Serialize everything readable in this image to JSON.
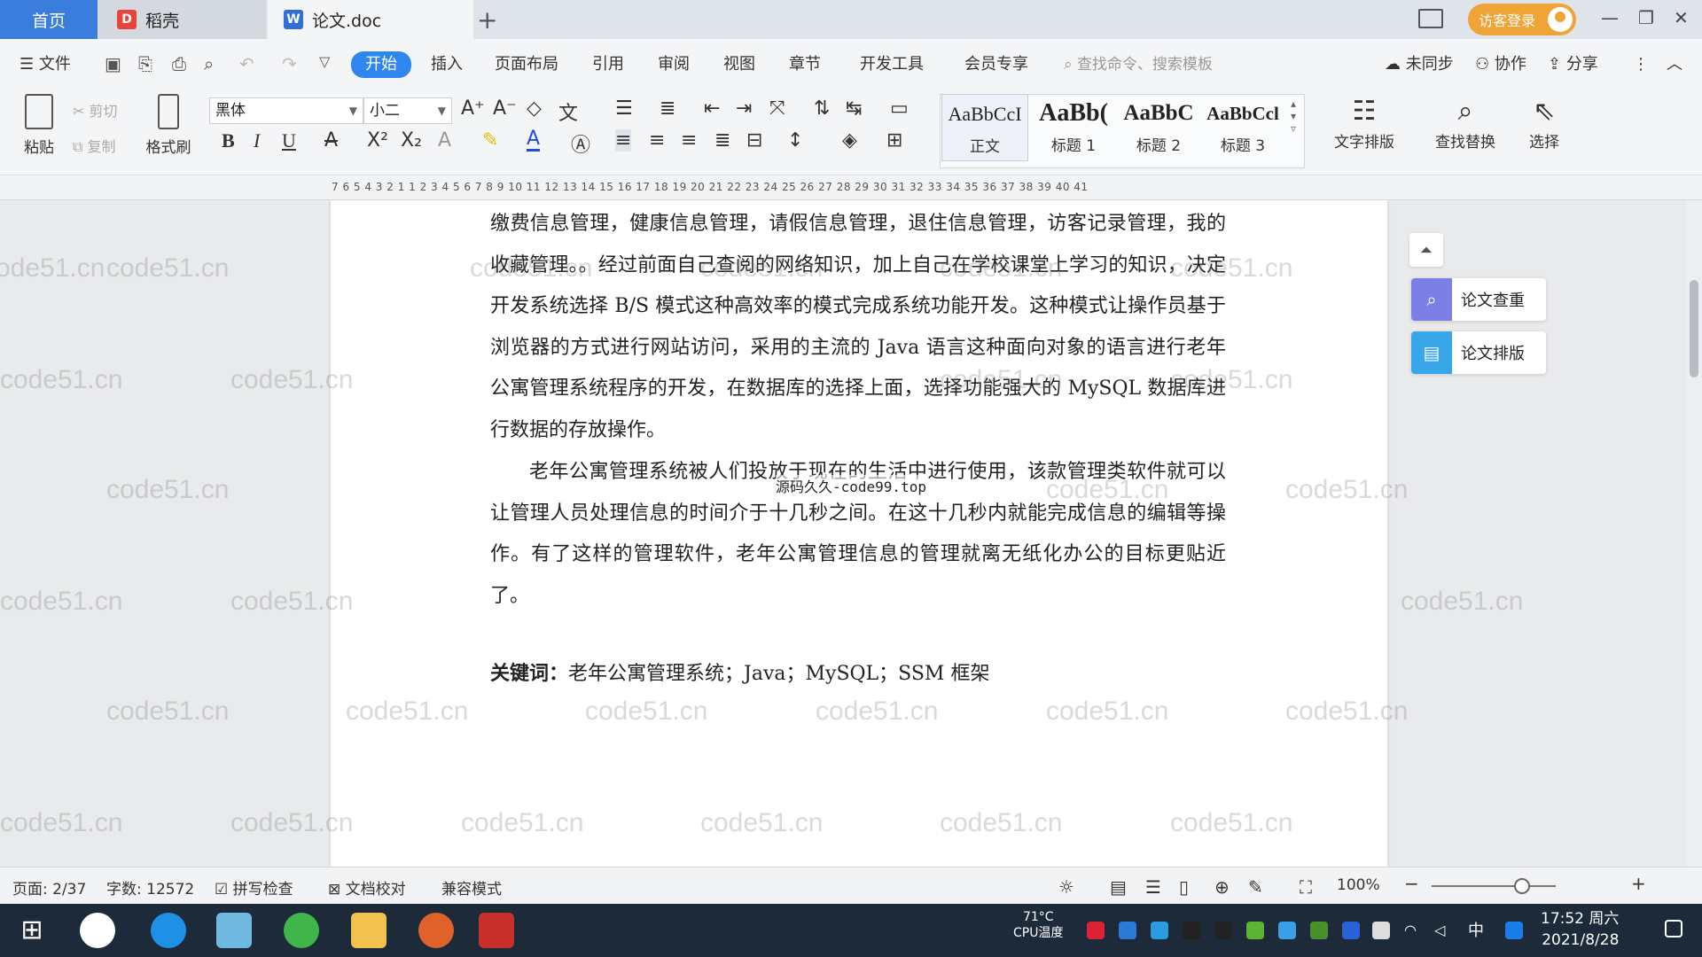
{
  "titlebar": {
    "tabs": [
      {
        "label": "首页"
      },
      {
        "label": "稻壳"
      },
      {
        "label": "论文.doc"
      }
    ],
    "new_tab": "+",
    "login_label": "访客登录"
  },
  "menu": {
    "file": "文件",
    "items": [
      "开始",
      "插入",
      "页面布局",
      "引用",
      "审阅",
      "视图",
      "章节",
      "开发工具",
      "会员专享"
    ],
    "search_placeholder": "查找命令、搜索模板",
    "right": {
      "sync": "未同步",
      "collab": "协作",
      "share": "分享"
    }
  },
  "ribbon": {
    "paste": "粘贴",
    "cut": "剪切",
    "copy": "复制",
    "format_painter": "格式刷",
    "font_name": "黑体",
    "font_size": "小二",
    "styles": [
      {
        "sample": "AaBbCcI",
        "label": "正文"
      },
      {
        "sample": "AaBb(",
        "label": "标题 1"
      },
      {
        "sample": "AaBbC",
        "label": "标题 2"
      },
      {
        "sample": "AaBbCcl",
        "label": "标题 3"
      }
    ],
    "text_layout": "文字排版",
    "find_replace": "查找替换",
    "select": "选择"
  },
  "ruler": {
    "ticks": "7  6  5  4  3  2  1     1  2  3  4  5  6  7  8  9  10  11  12  13  14  15  16  17  18  19  20  21  22  23  24  25  26  27  28  29  30  31  32  33  34  35  36  37  38  39  40  41"
  },
  "document": {
    "paragraph1": "缴费信息管理，健康信息管理，请假信息管理，退住信息管理，访客记录管理，我的收藏管理。。经过前面自己查阅的网络知识，加上自己在学校课堂上学习的知识，决定开发系统选择 B/S 模式这种高效率的模式完成系统功能开发。这种模式让操作员基于浏览器的方式进行网站访问，采用的主流的 Java 语言这种面向对象的语言进行老年公寓管理系统程序的开发，在数据库的选择上面，选择功能强大的 MySQL 数据库进行数据的存放操作。",
    "paragraph2": "老年公寓管理系统被人们投放于现在的生活中进行使用，该款管理类软件就可以让管理人员处理信息的时间介于十几秒之间。在这十几秒内就能完成信息的编辑等操作。有了这样的管理软件，老年公寓管理信息的管理就离无纸化办公的目标更贴近了。",
    "keywords_label": "关键词：",
    "keywords_text": "老年公寓管理系统；Java；MySQL；SSM 框架",
    "center_watermark": "源码久久-code99.top",
    "watermark": "code51.cn"
  },
  "side_panel": {
    "check": "论文查重",
    "layout": "论文排版"
  },
  "statusbar": {
    "page": "页面: 2/37",
    "words": "字数: 12572",
    "spell": "拼写检查",
    "proof": "文档校对",
    "compat": "兼容模式",
    "zoom": "100%"
  },
  "taskbar": {
    "cpu_temp": "71°C",
    "cpu_label": "CPU温度",
    "ime": "中",
    "time": "17:52 周六",
    "date": "2021/8/28"
  },
  "colors": {
    "accent": "#2f86ef",
    "home_tab": "#3b7ddd",
    "login": "#f0a436",
    "taskbar": "#1c2a3a"
  }
}
